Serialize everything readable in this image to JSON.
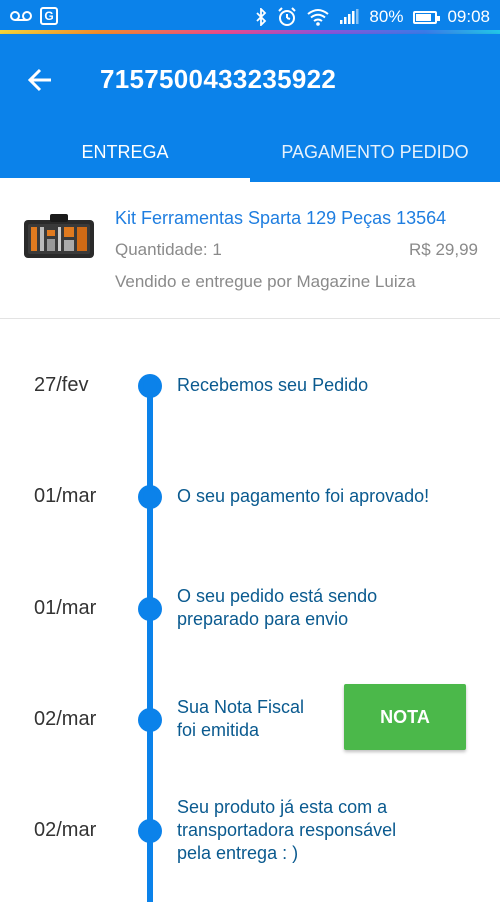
{
  "status_bar": {
    "battery": "80%",
    "time": "09:08",
    "battery_level": 0.8,
    "icons": [
      "voicemail-icon",
      "translate-icon",
      "bluetooth-icon",
      "alarm-icon",
      "wifi-icon",
      "signal-icon",
      "battery-icon"
    ]
  },
  "header": {
    "title": "7157500433235922",
    "back_icon": "arrow-left-icon"
  },
  "tabs": [
    {
      "label": "ENTREGA",
      "active": true
    },
    {
      "label": "PAGAMENTO PEDIDO",
      "active": false
    }
  ],
  "product": {
    "name": "Kit Ferramentas Sparta 129 Peças 13564",
    "quantity": "Quantidade: 1",
    "price": "R$ 29,99",
    "seller": "Vendido e entregue por Magazine Luiza"
  },
  "timeline": [
    {
      "date": "27/fev",
      "lines": [
        "Recebemos seu Pedido"
      ]
    },
    {
      "date": "01/mar",
      "lines": [
        "O seu pagamento foi aprovado!"
      ]
    },
    {
      "date": "01/mar",
      "lines": [
        "O seu pedido está sendo",
        "preparado para envio"
      ]
    },
    {
      "date": "02/mar",
      "lines": [
        "Sua Nota Fiscal",
        "foi emitida"
      ]
    },
    {
      "date": "02/mar",
      "lines": [
        "Seu produto já esta com a",
        "transportadora responsável",
        "pela entrega : )"
      ]
    }
  ],
  "nota_button": "NOTA",
  "colors": {
    "primary": "#0b82ea",
    "accent_green": "#4bb84a",
    "link_blue": "#1f7ee0",
    "timeline_text": "#0a5a8f"
  }
}
